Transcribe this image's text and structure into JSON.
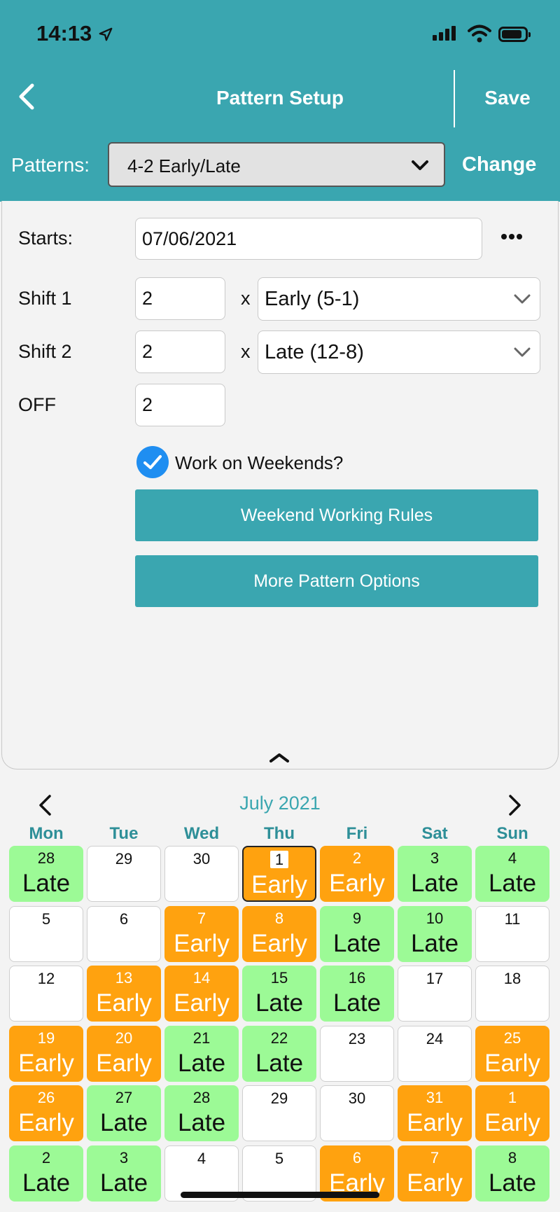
{
  "status_bar": {
    "time": "14:13"
  },
  "header": {
    "title": "Pattern Setup",
    "save_label": "Save"
  },
  "patterns": {
    "label": "Patterns:",
    "selected": "4-2 Early/Late",
    "change_label": "Change"
  },
  "form": {
    "starts_label": "Starts:",
    "starts_value": "07/06/2021",
    "shift1_label": "Shift 1",
    "shift1_count": "2",
    "shift1_type": "Early (5-1)",
    "shift2_label": "Shift 2",
    "shift2_count": "2",
    "shift2_type": "Late (12-8)",
    "off_label": "OFF",
    "off_count": "2",
    "times_symbol": "x",
    "weekends_label": "Work on Weekends?",
    "weekends_checked": true,
    "weekend_rules_button": "Weekend Working Rules",
    "more_options_button": "More Pattern Options"
  },
  "calendar": {
    "month_title": "July 2021",
    "weekdays": [
      "Mon",
      "Tue",
      "Wed",
      "Thu",
      "Fri",
      "Sat",
      "Sun"
    ],
    "colors": {
      "early": "#ffa20f",
      "late": "#9cfa96",
      "off": "#ffffff"
    },
    "weeks": [
      [
        {
          "day": "28",
          "shift": "Late"
        },
        {
          "day": "29",
          "shift": ""
        },
        {
          "day": "30",
          "shift": ""
        },
        {
          "day": "1",
          "shift": "Early",
          "today": true
        },
        {
          "day": "2",
          "shift": "Early"
        },
        {
          "day": "3",
          "shift": "Late"
        },
        {
          "day": "4",
          "shift": "Late"
        }
      ],
      [
        {
          "day": "5",
          "shift": ""
        },
        {
          "day": "6",
          "shift": ""
        },
        {
          "day": "7",
          "shift": "Early"
        },
        {
          "day": "8",
          "shift": "Early"
        },
        {
          "day": "9",
          "shift": "Late"
        },
        {
          "day": "10",
          "shift": "Late"
        },
        {
          "day": "11",
          "shift": ""
        }
      ],
      [
        {
          "day": "12",
          "shift": ""
        },
        {
          "day": "13",
          "shift": "Early"
        },
        {
          "day": "14",
          "shift": "Early"
        },
        {
          "day": "15",
          "shift": "Late"
        },
        {
          "day": "16",
          "shift": "Late"
        },
        {
          "day": "17",
          "shift": ""
        },
        {
          "day": "18",
          "shift": ""
        }
      ],
      [
        {
          "day": "19",
          "shift": "Early"
        },
        {
          "day": "20",
          "shift": "Early"
        },
        {
          "day": "21",
          "shift": "Late"
        },
        {
          "day": "22",
          "shift": "Late"
        },
        {
          "day": "23",
          "shift": ""
        },
        {
          "day": "24",
          "shift": ""
        },
        {
          "day": "25",
          "shift": "Early"
        }
      ],
      [
        {
          "day": "26",
          "shift": "Early"
        },
        {
          "day": "27",
          "shift": "Late"
        },
        {
          "day": "28",
          "shift": "Late"
        },
        {
          "day": "29",
          "shift": ""
        },
        {
          "day": "30",
          "shift": ""
        },
        {
          "day": "31",
          "shift": "Early"
        },
        {
          "day": "1",
          "shift": "Early"
        }
      ],
      [
        {
          "day": "2",
          "shift": "Late"
        },
        {
          "day": "3",
          "shift": "Late"
        },
        {
          "day": "4",
          "shift": ""
        },
        {
          "day": "5",
          "shift": ""
        },
        {
          "day": "6",
          "shift": "Early"
        },
        {
          "day": "7",
          "shift": "Early"
        },
        {
          "day": "8",
          "shift": "Late"
        }
      ]
    ]
  },
  "icons": [
    "location-arrow-icon",
    "signal-icon",
    "wifi-icon",
    "battery-icon",
    "back-chevron-icon",
    "chevron-down-icon",
    "more-dots-icon",
    "checkmark-icon",
    "collapse-chevron-icon",
    "chevron-left-icon",
    "chevron-right-icon"
  ]
}
